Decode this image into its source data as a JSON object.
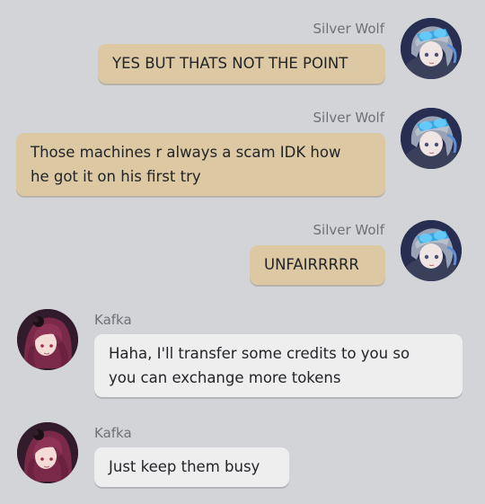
{
  "messages": [
    {
      "sender": "Silver Wolf",
      "avatar_icon": "silver-wolf-avatar-icon",
      "lines": [
        "YES BUT THATS NOT THE POINT"
      ]
    },
    {
      "sender": "Silver Wolf",
      "avatar_icon": "silver-wolf-avatar-icon",
      "lines": [
        "Those machines r always a scam IDK how",
        "he got it on his first try"
      ]
    },
    {
      "sender": "Silver Wolf",
      "avatar_icon": "silver-wolf-avatar-icon",
      "lines": [
        "UNFAIRRRRR"
      ]
    },
    {
      "sender": "Kafka",
      "avatar_icon": "kafka-avatar-icon",
      "lines": [
        "Haha, I'll transfer some credits to you so",
        "you can exchange more tokens"
      ]
    },
    {
      "sender": "Kafka",
      "avatar_icon": "kafka-avatar-icon",
      "lines": [
        "Just keep them busy"
      ]
    }
  ],
  "colors": {
    "background": "#d2d4d7",
    "outgoing_bubble": "#dcc8a2",
    "incoming_bubble": "#eeeeef",
    "sender_name": "#6e7177"
  }
}
